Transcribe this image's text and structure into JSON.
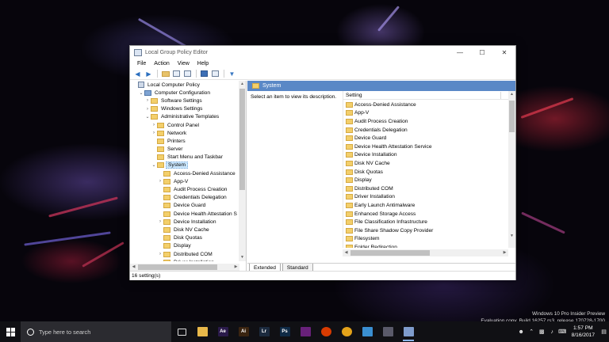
{
  "window": {
    "title": "Local Group Policy Editor",
    "controls": {
      "minimize": "—",
      "maximize": "☐",
      "close": "✕"
    }
  },
  "menu": [
    "File",
    "Action",
    "View",
    "Help"
  ],
  "tree": {
    "items": [
      {
        "label": "Local Computer Policy",
        "level": 0,
        "icon": "policy-book",
        "expander": ""
      },
      {
        "label": "Computer Configuration",
        "level": 1,
        "icon": "computer",
        "expander": "⌄"
      },
      {
        "label": "Software Settings",
        "level": 2,
        "icon": "folder",
        "expander": "›"
      },
      {
        "label": "Windows Settings",
        "level": 2,
        "icon": "folder",
        "expander": "›"
      },
      {
        "label": "Administrative Templates",
        "level": 2,
        "icon": "folder",
        "expander": "⌄"
      },
      {
        "label": "Control Panel",
        "level": 3,
        "icon": "folder",
        "expander": "›"
      },
      {
        "label": "Network",
        "level": 3,
        "icon": "folder",
        "expander": "›"
      },
      {
        "label": "Printers",
        "level": 3,
        "icon": "folder",
        "expander": ""
      },
      {
        "label": "Server",
        "level": 3,
        "icon": "folder",
        "expander": ""
      },
      {
        "label": "Start Menu and Taskbar",
        "level": 3,
        "icon": "folder",
        "expander": ""
      },
      {
        "label": "System",
        "level": 3,
        "icon": "folder",
        "expander": "⌄",
        "selected": true
      },
      {
        "label": "Access-Denied Assistance",
        "level": 4,
        "icon": "folder",
        "expander": ""
      },
      {
        "label": "App-V",
        "level": 4,
        "icon": "folder",
        "expander": "›"
      },
      {
        "label": "Audit Process Creation",
        "level": 4,
        "icon": "folder",
        "expander": ""
      },
      {
        "label": "Credentials Delegation",
        "level": 4,
        "icon": "folder",
        "expander": ""
      },
      {
        "label": "Device Guard",
        "level": 4,
        "icon": "folder",
        "expander": ""
      },
      {
        "label": "Device Health Attestation S",
        "level": 4,
        "icon": "folder",
        "expander": ""
      },
      {
        "label": "Device Installation",
        "level": 4,
        "icon": "folder",
        "expander": "›"
      },
      {
        "label": "Disk NV Cache",
        "level": 4,
        "icon": "folder",
        "expander": ""
      },
      {
        "label": "Disk Quotas",
        "level": 4,
        "icon": "folder",
        "expander": ""
      },
      {
        "label": "Display",
        "level": 4,
        "icon": "folder",
        "expander": ""
      },
      {
        "label": "Distributed COM",
        "level": 4,
        "icon": "folder",
        "expander": "›"
      },
      {
        "label": "Driver Installation",
        "level": 4,
        "icon": "folder",
        "expander": ""
      }
    ]
  },
  "details": {
    "header": "System",
    "description": "Select an item to view its description.",
    "column_header": "Setting",
    "items": [
      "Access-Denied Assistance",
      "App-V",
      "Audit Process Creation",
      "Credentials Delegation",
      "Device Guard",
      "Device Health Attestation Service",
      "Device Installation",
      "Disk NV Cache",
      "Disk Quotas",
      "Display",
      "Distributed COM",
      "Driver Installation",
      "Early Launch Antimalware",
      "Enhanced Storage Access",
      "File Classification Infrastructure",
      "File Share Shadow Copy Provider",
      "Filesystem",
      "Folder Redirection"
    ]
  },
  "tabs": {
    "extended": "Extended",
    "standard": "Standard"
  },
  "status": {
    "text": "16 setting(s)"
  },
  "watermark": {
    "line1": "Windows 10 Pro Insider Preview",
    "line2": "Evaluation copy. Build 16257.rs3_release.170728-1700"
  },
  "taskbar": {
    "search_placeholder": "Type here to search",
    "apps": [
      {
        "name": "task-view",
        "label": "",
        "color": "#101014"
      },
      {
        "name": "file-explorer",
        "label": "",
        "color": "#e8b84a"
      },
      {
        "name": "after-effects",
        "label": "Ae",
        "color": "#2a1a4a"
      },
      {
        "name": "illustrator",
        "label": "Ai",
        "color": "#3a2410"
      },
      {
        "name": "lightroom",
        "label": "Lr",
        "color": "#1b2a3e"
      },
      {
        "name": "photoshop",
        "label": "Ps",
        "color": "#0f2a45"
      },
      {
        "name": "visual-studio",
        "label": "",
        "color": "#68217a"
      },
      {
        "name": "office",
        "label": "",
        "color": "#d83b01"
      },
      {
        "name": "chrome",
        "label": "",
        "color": "#e3a21a"
      },
      {
        "name": "notepad",
        "label": "",
        "color": "#3a8fd1"
      },
      {
        "name": "mmc",
        "label": "",
        "color": "#5a5a6a"
      },
      {
        "name": "group-policy",
        "label": "",
        "color": "#7f9ccc"
      }
    ],
    "time": "1:57 PM",
    "date": "8/16/2017"
  }
}
